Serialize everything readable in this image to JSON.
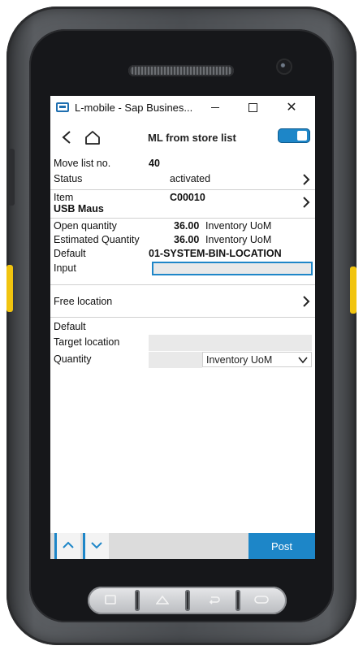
{
  "window": {
    "title": "L-mobile - Sap Busines...",
    "close_glyph": "✕"
  },
  "nav": {
    "title": "ML from store list"
  },
  "form": {
    "move_list_label": "Move list no.",
    "move_list_value": "40",
    "status_label": "Status",
    "status_value": "activated",
    "item_label": "Item",
    "item_name": "USB Maus",
    "item_code": "C00010",
    "open_qty_label": "Open quantity",
    "open_qty_value": "36.00",
    "open_qty_unit": "Inventory UoM",
    "est_qty_label": "Estimated Quantity",
    "est_qty_value": "36.00",
    "est_qty_unit": "Inventory UoM",
    "default_label": "Default",
    "default_value": "01-SYSTEM-BIN-LOCATION",
    "input_label": "Input",
    "input_value": "",
    "free_location_label": "Free location",
    "default2_label": "Default",
    "target_location_label": "Target location",
    "target_location_value": "",
    "quantity_label": "Quantity",
    "quantity_value": "",
    "quantity_unit_selected": "Inventory UoM"
  },
  "actions": {
    "post_label": "Post"
  },
  "colors": {
    "accent": "#1d86c8",
    "device_body": "#4b4e52",
    "side_keys": "#f1c40f"
  },
  "icons": {
    "back": "chevron-left-icon",
    "home": "home-icon",
    "toggle": "toggle-switch-icon",
    "row_nav": "chevron-right-icon",
    "dropdown": "chevron-down-icon",
    "up": "arrow-up-icon",
    "down": "arrow-down-icon"
  }
}
